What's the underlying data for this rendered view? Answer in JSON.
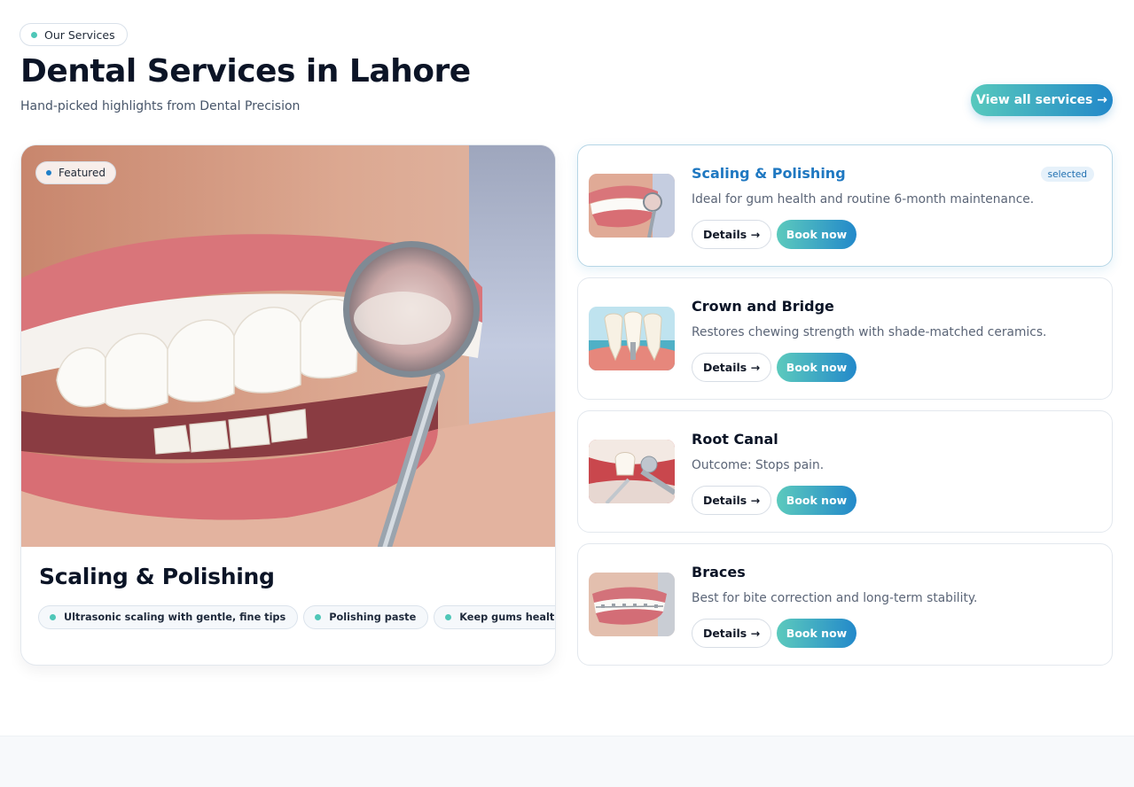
{
  "header": {
    "eyebrow": "Our Services",
    "title": "Dental Services in Lahore",
    "subtitle": "Hand-picked highlights from Dental Precision",
    "view_all_label": "View all services →"
  },
  "featured": {
    "badge": "Featured",
    "title": "Scaling & Polishing",
    "chips": [
      "Ultrasonic scaling with gentle, fine tips",
      "Polishing paste",
      "Keep gums healthy"
    ]
  },
  "services": [
    {
      "name": "Scaling & Polishing",
      "description": "Ideal for gum health and routine 6-month maintenance.",
      "selected_label": "selected",
      "details_label": "Details →",
      "book_label": "Book now"
    },
    {
      "name": "Crown and Bridge",
      "description": "Restores chewing strength with shade-matched ceramics.",
      "details_label": "Details →",
      "book_label": "Book now"
    },
    {
      "name": "Root Canal",
      "description": "Outcome: Stops pain.",
      "details_label": "Details →",
      "book_label": "Book now"
    },
    {
      "name": "Braces",
      "description": "Best for bite correction and long-term stability.",
      "details_label": "Details →",
      "book_label": "Book now"
    }
  ],
  "colors": {
    "accent_start": "#57c9bd",
    "accent_end": "#2288c9",
    "selected_text": "#1f78c1",
    "heading": "#0b1426"
  }
}
